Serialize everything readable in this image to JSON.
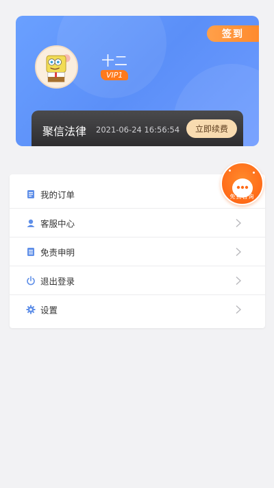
{
  "profile": {
    "signin_label": "签到",
    "username": "十二",
    "vip_label": "VIP1",
    "membership_name": "聚信法律",
    "membership_date": "2021-06-24 16:56:54",
    "renew_label": "立即续费"
  },
  "menu": {
    "items": [
      {
        "label": "我的订单",
        "icon": "order-icon",
        "has_chevron": false
      },
      {
        "label": "客服中心",
        "icon": "customer-service-icon",
        "has_chevron": true
      },
      {
        "label": "免责申明",
        "icon": "disclaimer-icon",
        "has_chevron": true
      },
      {
        "label": "退出登录",
        "icon": "power-icon",
        "has_chevron": true
      },
      {
        "label": "设置",
        "icon": "gear-icon",
        "has_chevron": true
      }
    ]
  },
  "consult": {
    "label": "免费咨询"
  },
  "colors": {
    "card_blue": "#5b8ff8",
    "accent_orange": "#ff8a2d",
    "icon_blue": "#5f8fe8"
  }
}
